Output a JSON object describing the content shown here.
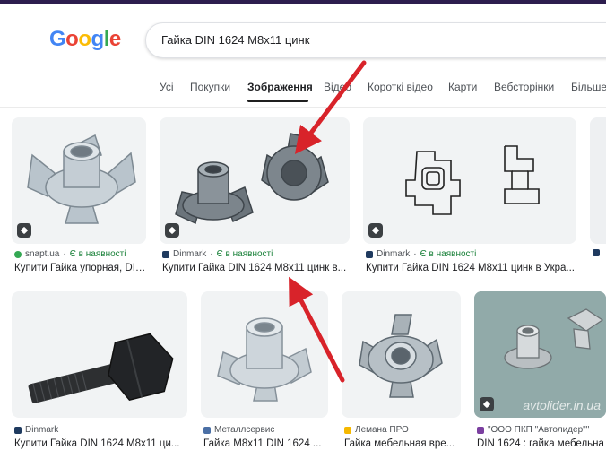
{
  "logo": {
    "letters": [
      "G",
      "o",
      "o",
      "g",
      "l",
      "e"
    ]
  },
  "search": {
    "query": "Гайка DIN 1624 M8x11 цинк"
  },
  "tabs": [
    {
      "label": "Усі"
    },
    {
      "label": "Покупки"
    },
    {
      "label": "Зображення"
    },
    {
      "label": "Відео"
    },
    {
      "label": "Короткі відео"
    },
    {
      "label": "Карти"
    },
    {
      "label": "Вебсторінки"
    },
    {
      "label": "Більше"
    }
  ],
  "results": [
    {
      "source": "snapt.ua",
      "availability": "Є в наявності",
      "title": "Купити Гайка упорная, DIN..."
    },
    {
      "source": "Dinmark",
      "availability": "Є в наявності",
      "title": "Купити Гайка DIN 1624 M8x11 цинк в..."
    },
    {
      "source": "Dinmark",
      "availability": "Є в наявності",
      "title": "Купити Гайка DIN 1624 M8x11 цинк в Укра..."
    },
    {
      "source": "Dinmark",
      "availability": "",
      "title": "Купити Гайка DIN 1624 M8x11 ци..."
    },
    {
      "source": "Металлсервис",
      "availability": "",
      "title": "Гайка M8x11 DIN 1624 ..."
    },
    {
      "source": "Лемана ПРО",
      "availability": "",
      "title": "Гайка мебельная вре..."
    },
    {
      "source": "\"ООО ПКП \"Автолидер\"\"",
      "availability": "",
      "title": "DIN 1624 : гайка мебельна"
    },
    {
      "source": "",
      "availability": "",
      "title": ""
    }
  ],
  "watermark": "avtolider.in.ua",
  "colors": {
    "blue": "#4285f4",
    "red": "#ea4335",
    "yellow": "#fbbc05",
    "green": "#34a853",
    "arrow": "#d8232a"
  }
}
